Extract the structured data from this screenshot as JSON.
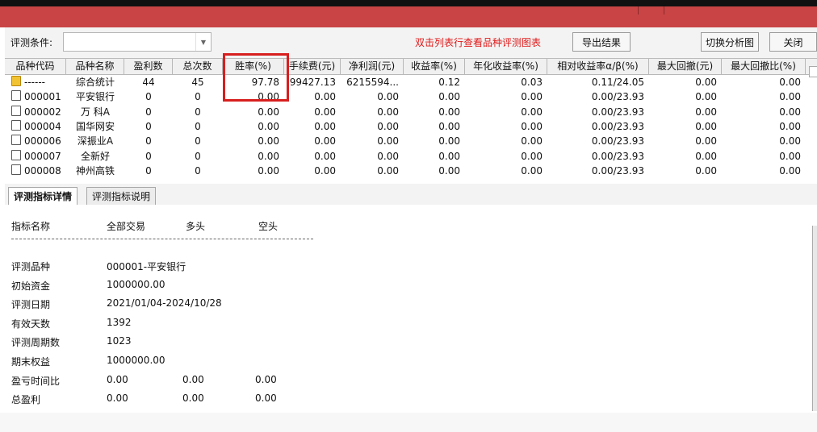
{
  "toolbar": {
    "condition_label": "评测条件:",
    "condition_value": "",
    "hint": "双击列表行查看品种评测图表",
    "export_label": "导出结果",
    "switch_label": "切换分析图",
    "close_label": "关闭"
  },
  "table": {
    "columns": [
      "品种代码",
      "品种名称",
      "盈利数",
      "总次数",
      "胜率(%)",
      "手续费(元)",
      "净利润(元)",
      "收益率(%)",
      "年化收益率(%)",
      "相对收益率α/β(%)",
      "最大回撤(元)",
      "最大回撤比(%)"
    ],
    "rows": [
      {
        "code": "------",
        "name": "综合统计",
        "wins": "44",
        "total": "45",
        "winrate": "97.78",
        "fee": "99427.13",
        "profit": "6215594...",
        "ret": "0.12",
        "annual": "0.03",
        "rel": "0.11/24.05",
        "dd": "0.00",
        "ddr": "0.00",
        "folder": true
      },
      {
        "code": "000001",
        "name": "平安银行",
        "wins": "0",
        "total": "0",
        "winrate": "0.00",
        "fee": "0.00",
        "profit": "0.00",
        "ret": "0.00",
        "annual": "0.00",
        "rel": "0.00/23.93",
        "dd": "0.00",
        "ddr": "0.00",
        "folder": false
      },
      {
        "code": "000002",
        "name": "万 科A",
        "wins": "0",
        "total": "0",
        "winrate": "0.00",
        "fee": "0.00",
        "profit": "0.00",
        "ret": "0.00",
        "annual": "0.00",
        "rel": "0.00/23.93",
        "dd": "0.00",
        "ddr": "0.00",
        "folder": false
      },
      {
        "code": "000004",
        "name": "国华网安",
        "wins": "0",
        "total": "0",
        "winrate": "0.00",
        "fee": "0.00",
        "profit": "0.00",
        "ret": "0.00",
        "annual": "0.00",
        "rel": "0.00/23.93",
        "dd": "0.00",
        "ddr": "0.00",
        "folder": false
      },
      {
        "code": "000006",
        "name": "深振业A",
        "wins": "0",
        "total": "0",
        "winrate": "0.00",
        "fee": "0.00",
        "profit": "0.00",
        "ret": "0.00",
        "annual": "0.00",
        "rel": "0.00/23.93",
        "dd": "0.00",
        "ddr": "0.00",
        "folder": false
      },
      {
        "code": "000007",
        "name": "全新好",
        "wins": "0",
        "total": "0",
        "winrate": "0.00",
        "fee": "0.00",
        "profit": "0.00",
        "ret": "0.00",
        "annual": "0.00",
        "rel": "0.00/23.93",
        "dd": "0.00",
        "ddr": "0.00",
        "folder": false
      },
      {
        "code": "000008",
        "name": "神州高铁",
        "wins": "0",
        "total": "0",
        "winrate": "0.00",
        "fee": "0.00",
        "profit": "0.00",
        "ret": "0.00",
        "annual": "0.00",
        "rel": "0.00/23.93",
        "dd": "0.00",
        "ddr": "0.00",
        "folder": false
      }
    ]
  },
  "tabs": [
    "评测指标详情",
    "评测指标说明"
  ],
  "details": {
    "header": [
      "指标名称",
      "全部交易",
      "多头",
      "空头"
    ],
    "items": [
      {
        "label": "评测品种",
        "v1": "000001-平安银行"
      },
      {
        "label": "初始资金",
        "v1": "1000000.00"
      },
      {
        "label": "评测日期",
        "v1": "2021/01/04-2024/10/28"
      },
      {
        "label": "有效天数",
        "v1": "1392"
      },
      {
        "label": "评测周期数",
        "v1": "1023"
      },
      {
        "label": "期末权益",
        "v1": "1000000.00"
      },
      {
        "label": "盈亏时间比",
        "v1": "0.00",
        "v2": "0.00",
        "v3": "0.00"
      },
      {
        "label": "总盈利",
        "v1": "0.00",
        "v2": "0.00",
        "v3": "0.00"
      }
    ]
  },
  "colors": {
    "titlebar": "#c94444",
    "hint": "#e01818",
    "highlight": "#d81e1e"
  }
}
